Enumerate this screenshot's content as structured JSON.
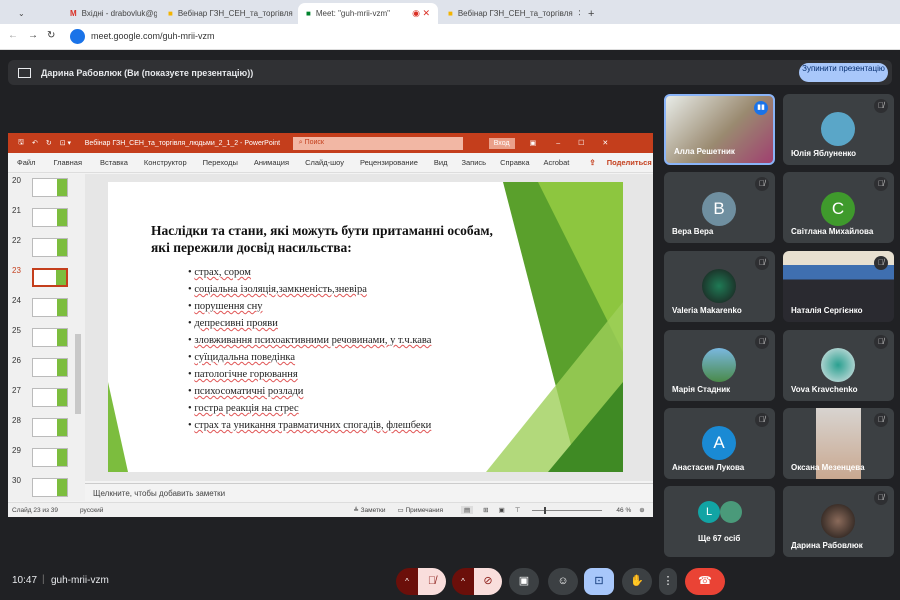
{
  "browser": {
    "tabs": [
      {
        "label": "Вхідні - drabovluk@gmail.com"
      },
      {
        "label": "Вебінар ГЗН_СЕН_та_торгівля"
      },
      {
        "label": "Meet: \"guh-mrii-vzm\""
      },
      {
        "label": "Вебінар ГЗН_СЕН_та_торгівля"
      }
    ],
    "new_tab": "+",
    "url": "meet.google.com/guh-mrii-vzm"
  },
  "presenting": {
    "text": "Дарина Рабовлюк (Ви (показуєте презентацію))",
    "stop_label": "Зупинити презентацію"
  },
  "ppt": {
    "title": "Вебінар ГЗН_СЕН_та_торгівля_людьми_2_1_2  -  PowerPoint",
    "search": "Поиск",
    "signin": "Вход",
    "ribbon": [
      "Файл",
      "Главная",
      "Вставка",
      "Конструктор",
      "Переходы",
      "Анимация",
      "Слайд-шоу",
      "Рецензирование",
      "Вид",
      "Запись",
      "Справка",
      "Acrobat"
    ],
    "share": "Поделиться",
    "thumbs": [
      "20",
      "21",
      "22",
      "23",
      "24",
      "25",
      "26",
      "27",
      "28",
      "29",
      "30"
    ],
    "slide": {
      "title": "Наслідки та стани, які можуть бути притаманні особам, які пережили досвід насильства:",
      "bullets": [
        "страх, сором",
        "соціальна ізоляція,замкненість,зневіра",
        "порушення сну",
        "депресивні прояви",
        "зловживання психоактивними речовинами, у т.ч.кава",
        "суїцидальна поведінка",
        "патологічне горювання",
        "психосоматичні розлади",
        "гостра реакція на стрес",
        "страх та уникання травматичних спогадів, флешбеки"
      ]
    },
    "notes_placeholder": "Щелкните, чтобы добавить заметки",
    "status": {
      "slide": "Слайд 23 из 39",
      "lang": "русский",
      "notes": "Заметки",
      "comments": "Примечания",
      "zoom": "46 %"
    }
  },
  "participants": [
    {
      "name": "Алла Решетник",
      "type": "video",
      "color": "#8a6d5a",
      "speaking": true
    },
    {
      "name": "Юлія Яблуненко",
      "type": "avatar",
      "color": "#5aa6c8",
      "initial": ""
    },
    {
      "name": "Вера Вера",
      "type": "avatar",
      "color": "#6f8fa0",
      "initial": "В"
    },
    {
      "name": "Світлана Михайлова",
      "type": "avatar",
      "color": "#3f9a2c",
      "initial": "С"
    },
    {
      "name": "Valeria Makarenko",
      "type": "avatar",
      "color": "#2d5c46",
      "initial": ""
    },
    {
      "name": "Наталія Сергієнко",
      "type": "video",
      "color": "#6f6a8a"
    },
    {
      "name": "Марія Стадник",
      "type": "avatar",
      "color": "#5f9d6a",
      "initial": ""
    },
    {
      "name": "Vova Kravchenko",
      "type": "avatar",
      "color": "#d6dde0",
      "initial": ""
    },
    {
      "name": "Анастасия Лукова",
      "type": "avatar",
      "color": "#1a8ad4",
      "initial": "А"
    },
    {
      "name": "Оксана Мезенцева",
      "type": "video",
      "color": "#c9b8a8"
    },
    {
      "name": "Ще 67 осіб",
      "type": "more",
      "color": "#12a4a4",
      "initial": "L"
    },
    {
      "name": "Дарина Рабовлюк",
      "type": "avatar",
      "color": "#2a2420",
      "initial": ""
    }
  ],
  "bottom": {
    "time": "10:47",
    "meeting": "guh-mrii-vzm"
  },
  "colors": {
    "ppt": "#c43e1c",
    "stop": "#a8c7fa",
    "end": "#ea4335",
    "muted": "#f9dedc"
  }
}
